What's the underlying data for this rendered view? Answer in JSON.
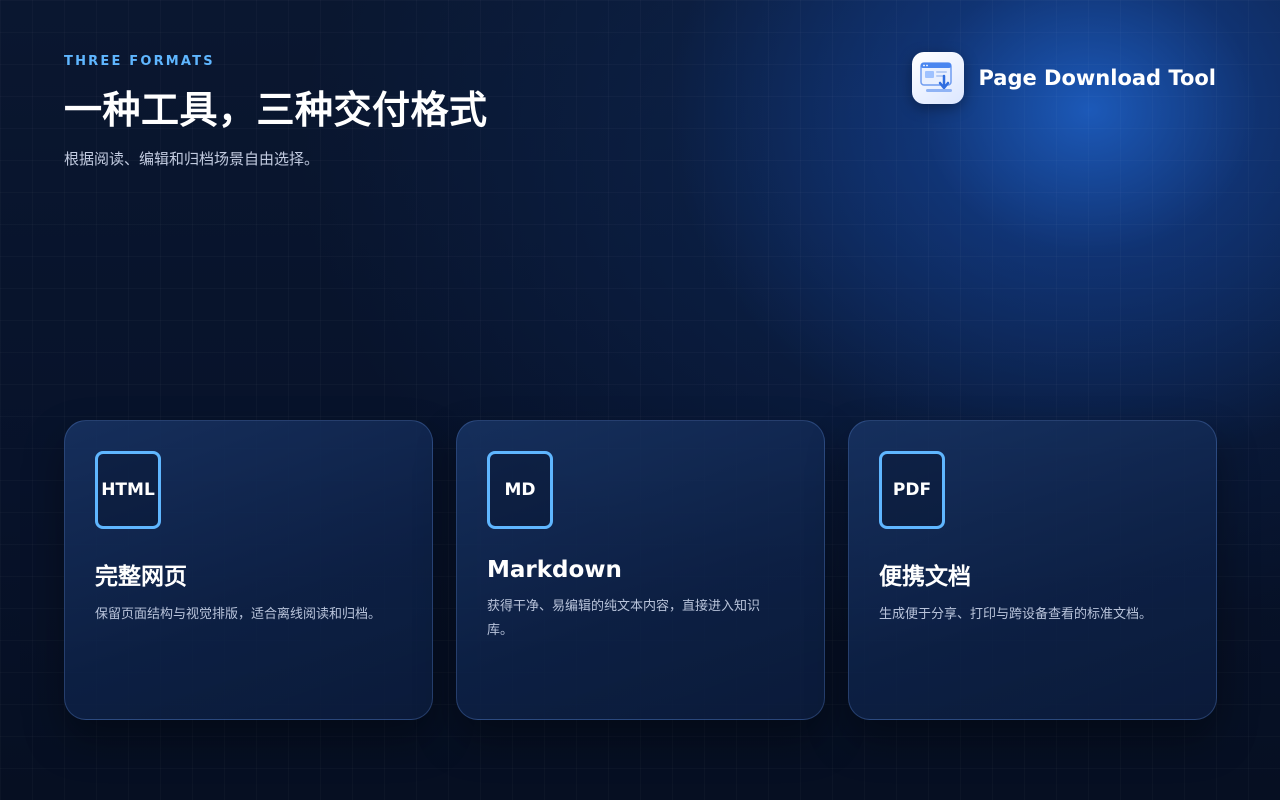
{
  "header": {
    "eyebrow": "THREE FORMATS",
    "title": "一种工具，三种交付格式",
    "subtitle": "根据阅读、编辑和归档场景自由选择。"
  },
  "brand": {
    "name": "Page Download Tool",
    "logo_icon": "app-logo-icon"
  },
  "cards": [
    {
      "badge": "HTML",
      "title": "完整网页",
      "description": "保留页面结构与视觉排版，适合离线阅读和归档。"
    },
    {
      "badge": "MD",
      "title": "Markdown",
      "description": "获得干净、易编辑的纯文本内容，直接进入知识库。"
    },
    {
      "badge": "PDF",
      "title": "便携文档",
      "description": "生成便于分享、打印与跨设备查看的标准文档。"
    }
  ],
  "colors": {
    "accent": "#5fb6ff",
    "background": "#081426",
    "glow": "#1d5cbe"
  }
}
